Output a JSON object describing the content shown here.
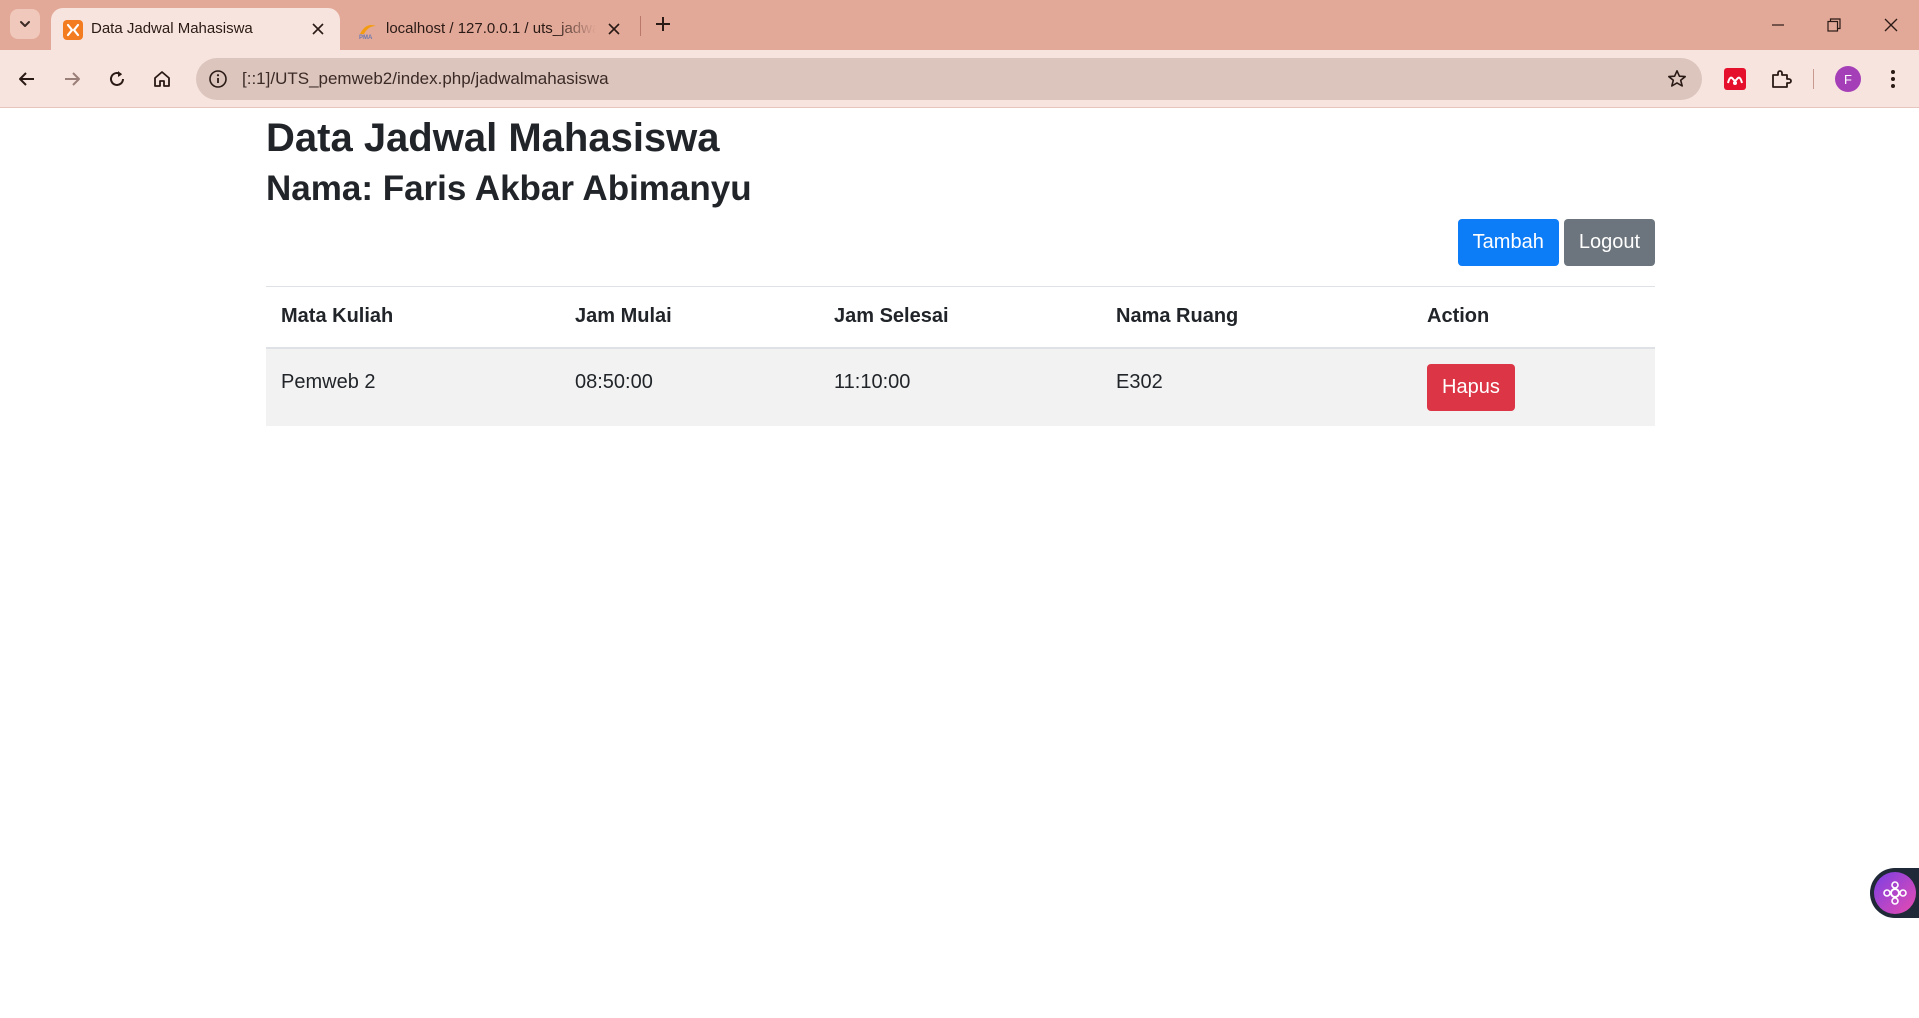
{
  "browser": {
    "tabs": [
      {
        "title": "Data Jadwal Mahasiswa",
        "active": true
      },
      {
        "title": "localhost / 127.0.0.1 / uts_jadwal",
        "active": false
      }
    ],
    "url": "[::1]/UTS_pemweb2/index.php/jadwalmahasiswa",
    "profile_initial": "F"
  },
  "page": {
    "title": "Data Jadwal Mahasiswa",
    "subtitle": "Nama: Faris Akbar Abimanyu",
    "buttons": {
      "add_label": "Tambah",
      "logout_label": "Logout"
    },
    "table": {
      "headers": [
        "Mata Kuliah",
        "Jam Mulai",
        "Jam Selesai",
        "Nama Ruang",
        "Action"
      ],
      "rows": [
        {
          "mata_kuliah": "Pemweb 2",
          "jam_mulai": "08:50:00",
          "jam_selesai": "11:10:00",
          "nama_ruang": "E302",
          "action_label": "Hapus"
        }
      ]
    }
  },
  "colors": {
    "primary": "#0d7cf7",
    "secondary": "#6c757d",
    "danger": "#dc3545",
    "chrome_frame": "#e3a998",
    "chrome_toolbar": "#f8e4de"
  }
}
